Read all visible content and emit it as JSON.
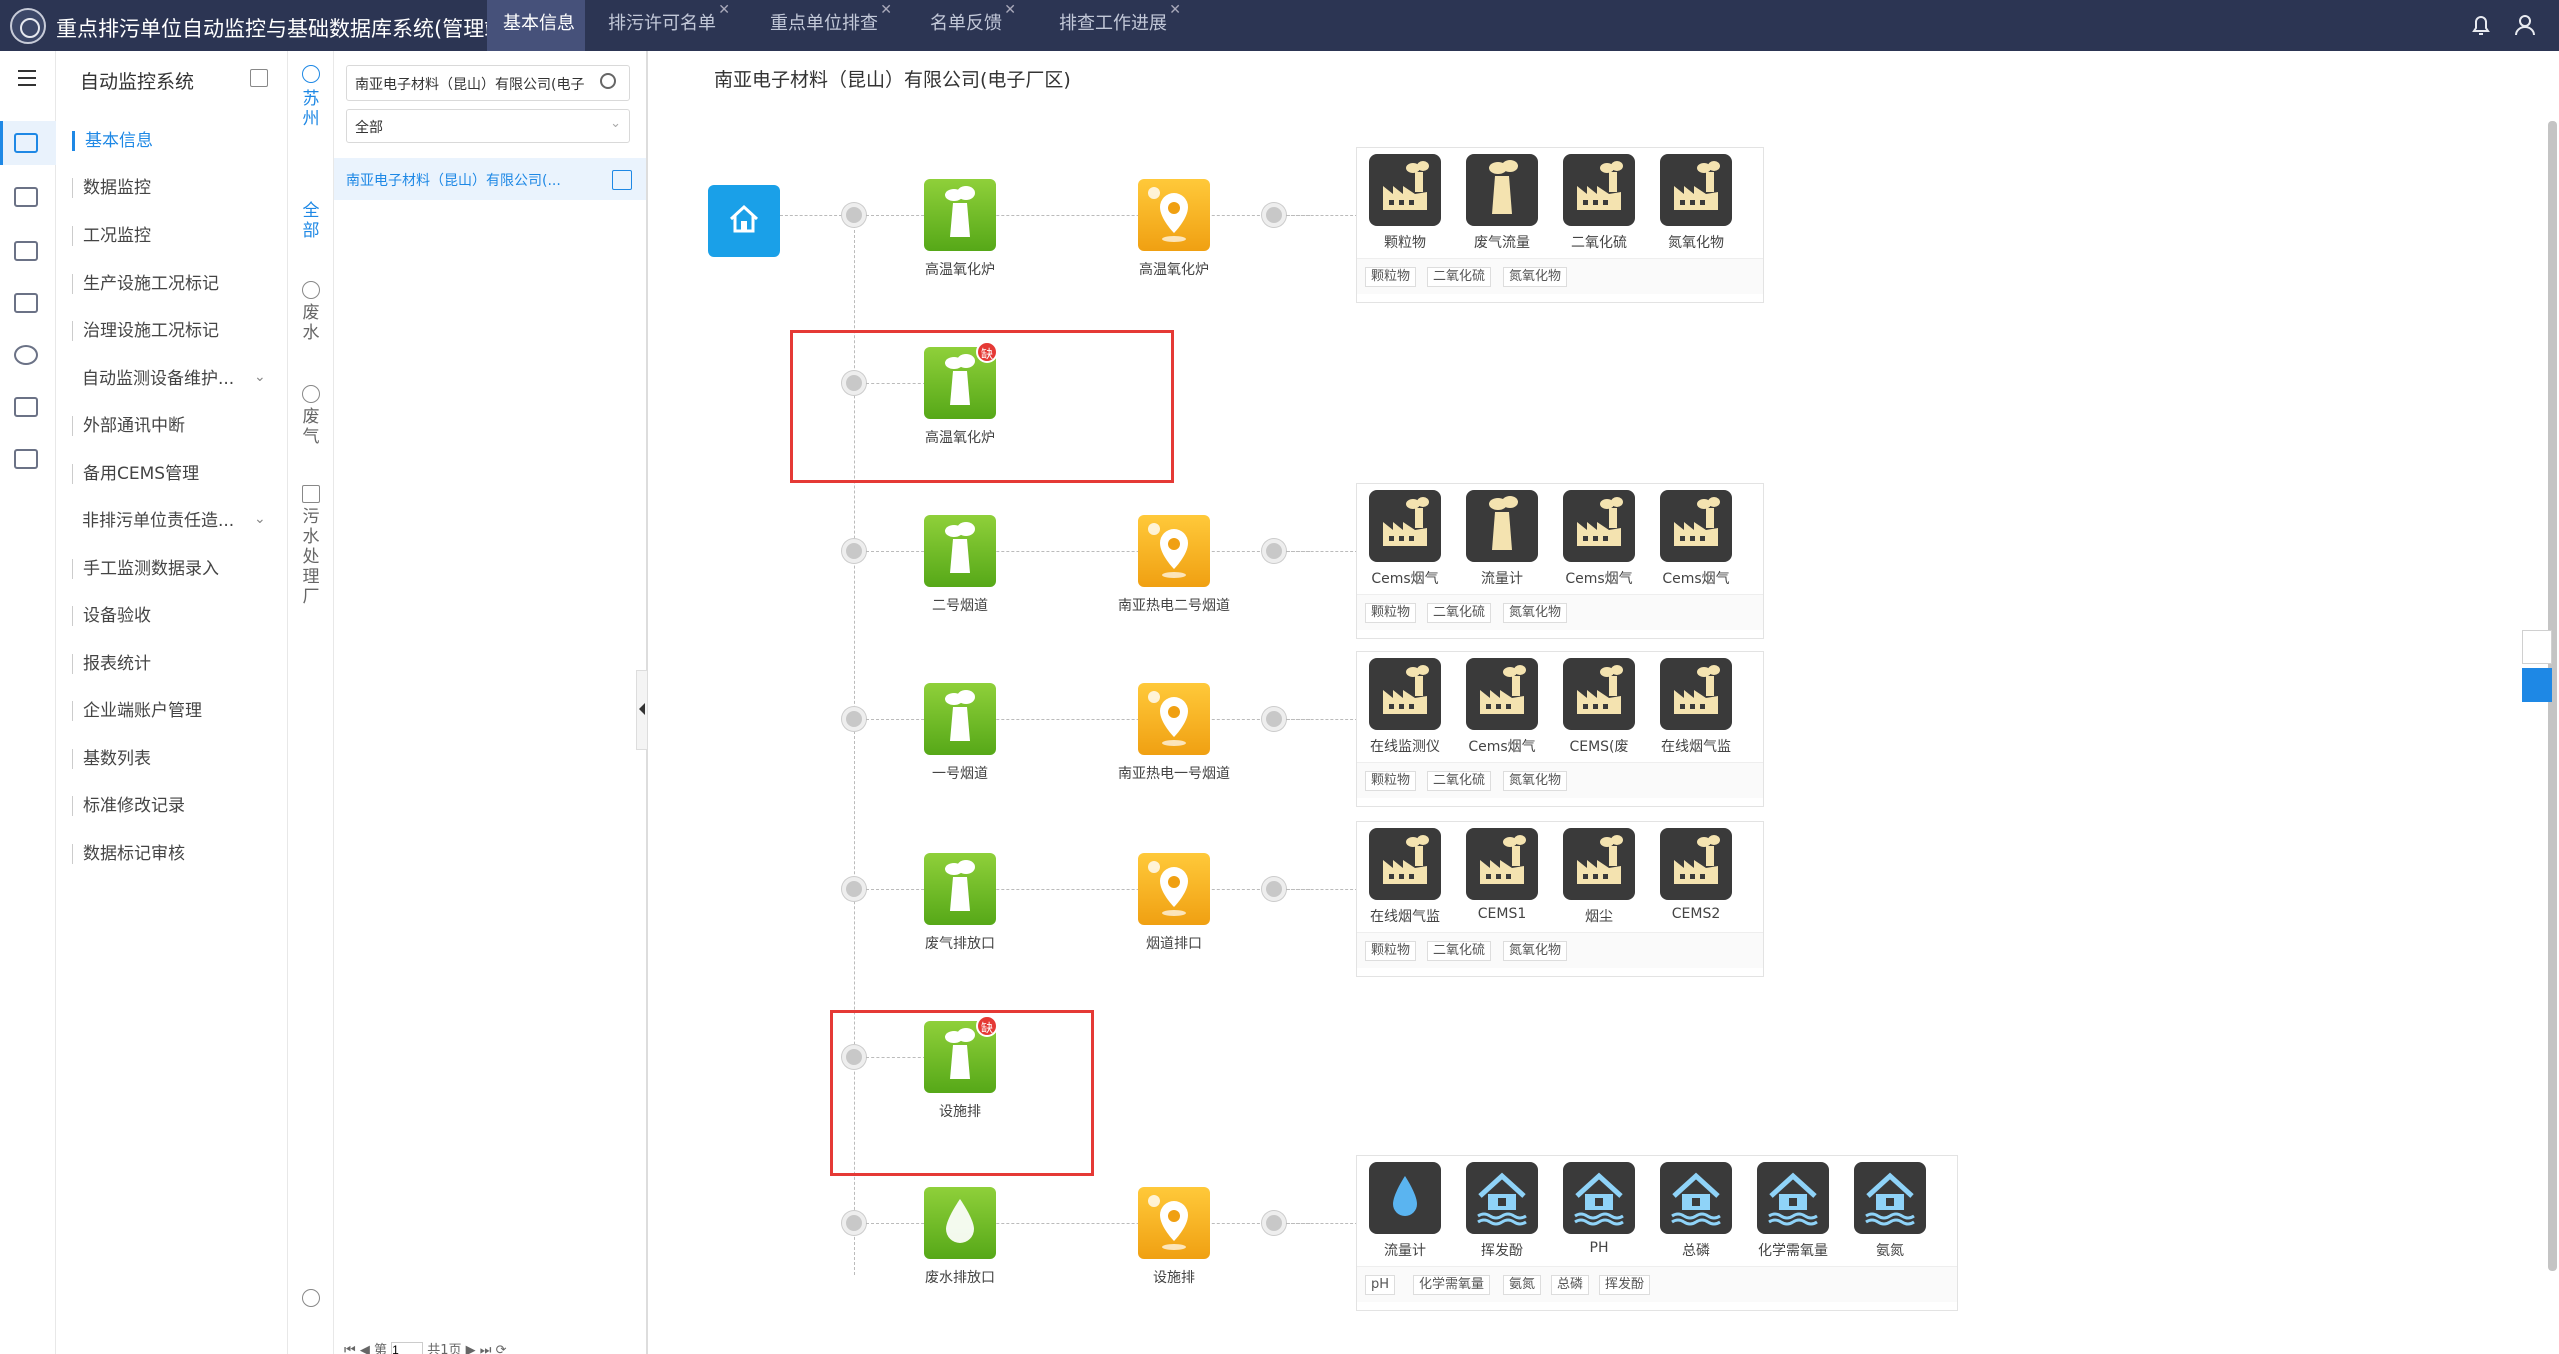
{
  "header": {
    "app_title": "重点排污单位自动监控与基础数据库系统(管理端)",
    "tabs": [
      {
        "label": "基本信息",
        "closable": false,
        "active": true
      },
      {
        "label": "排污许可名单",
        "closable": true
      },
      {
        "label": "重点单位排查",
        "closable": true
      },
      {
        "label": "名单反馈",
        "closable": true
      },
      {
        "label": "排查工作进展",
        "closable": true
      }
    ]
  },
  "menu": {
    "title": "自动监控系统",
    "items": [
      {
        "label": "基本信息",
        "active": true
      },
      {
        "label": "数据监控"
      },
      {
        "label": "工况监控"
      },
      {
        "label": "生产设施工况标记"
      },
      {
        "label": "治理设施工况标记"
      },
      {
        "label": "自动监测设备维护...",
        "expandable": true
      },
      {
        "label": "外部通讯中断"
      },
      {
        "label": "备用CEMS管理"
      },
      {
        "label": "非排污单位责任造...",
        "expandable": true
      },
      {
        "label": "手工监测数据录入"
      },
      {
        "label": "设备验收"
      },
      {
        "label": "报表统计"
      },
      {
        "label": "企业端账户管理"
      },
      {
        "label": "基数列表"
      },
      {
        "label": "标准修改记录"
      },
      {
        "label": "数据标记审核"
      }
    ]
  },
  "region": {
    "city": "苏州",
    "filters": [
      "全部",
      "废水",
      "废气",
      "污水处理厂"
    ]
  },
  "list": {
    "search_value": "南亚电子材料（昆山）有限公司(电子",
    "select_value": "全部",
    "items": [
      "南亚电子材料（昆山）有限公司(..."
    ],
    "pager": {
      "prefix": "第",
      "page": "1",
      "total": "共1页"
    }
  },
  "main": {
    "enterprise": "南亚电子材料（昆山）有限公司(电子厂区)",
    "flows": [
      {
        "source": "高温氧化炉",
        "outlet": "高温氧化炉",
        "factors": [
          "颗粒物",
          "废气流量",
          "二氧化硫",
          "氮氧化物"
        ],
        "tags": [
          "颗粒物",
          "二氧化硫",
          "氮氧化物"
        ]
      },
      {
        "source": "高温氧化炉",
        "missing": true,
        "badge": "缺"
      },
      {
        "source": "二号烟道",
        "outlet": "南亚热电二号烟道",
        "factors": [
          "Cems烟气",
          "流量计",
          "Cems烟气",
          "Cems烟气"
        ],
        "tags": [
          "颗粒物",
          "二氧化硫",
          "氮氧化物"
        ]
      },
      {
        "source": "一号烟道",
        "outlet": "南亚热电一号烟道",
        "factors": [
          "在线监测仪",
          "Cems烟气",
          "CEMS(废",
          "在线烟气监"
        ],
        "tags": [
          "颗粒物",
          "二氧化硫",
          "氮氧化物"
        ]
      },
      {
        "source": "废气排放口",
        "outlet": "烟道排口",
        "factors": [
          "在线烟气监",
          "CEMS1",
          "烟尘",
          "CEMS2"
        ],
        "tags": [
          "颗粒物",
          "二氧化硫",
          "氮氧化物"
        ]
      },
      {
        "source": "设施排",
        "missing": true,
        "badge": "缺"
      },
      {
        "source": "废水排放口",
        "outlet": "设施排",
        "factors": [
          "流量计",
          "挥发酚",
          "PH",
          "总磷",
          "化学需氧量",
          "氨氮"
        ],
        "tags": [
          "pH",
          "化学需氧量",
          "氨氮",
          "总磷",
          "挥发酚"
        ]
      }
    ]
  },
  "colors": {
    "accent": "#1e88e5",
    "topbar": "#2c3553",
    "green": "#6abf2a",
    "orange": "#f5b021",
    "alert": "#e53935"
  }
}
